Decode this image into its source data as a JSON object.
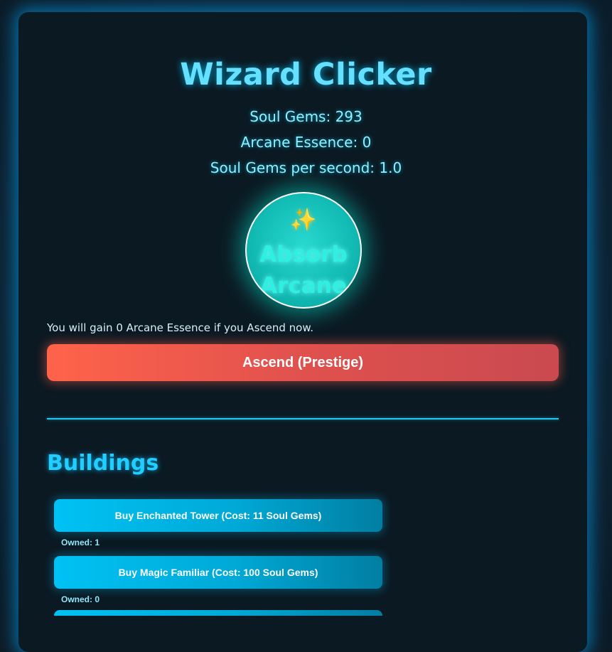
{
  "app": {
    "title": "Wizard Clicker"
  },
  "stats": {
    "soul_gems": "Soul Gems: 293",
    "arcane_essence": "Arcane Essence: 0",
    "per_second": "Soul Gems per second: 1.0"
  },
  "orb": {
    "icon": "sparkles-icon",
    "glyph": "✨",
    "label_line1": "Absorb",
    "label_line2": "Arcane"
  },
  "prestige": {
    "gain_text": "You will gain 0 Arcane Essence if you Ascend now.",
    "button_label": "Ascend (Prestige)"
  },
  "buildings": {
    "heading": "Buildings",
    "items": [
      {
        "button_label": "Buy Enchanted Tower (Cost: 11 Soul Gems)",
        "owned_label": "Owned: 1"
      },
      {
        "button_label": "Buy Magic Familiar (Cost: 100 Soul Gems)",
        "owned_label": "Owned: 0"
      }
    ]
  },
  "colors": {
    "accent": "#20cfff",
    "orb": "#13bdb6",
    "ascend": "#ff634a",
    "background": "#0b1922"
  }
}
